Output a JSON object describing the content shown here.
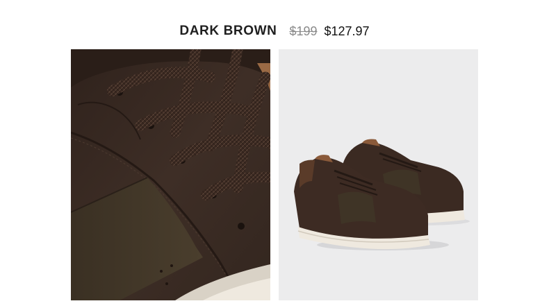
{
  "product": {
    "color_name": "DARK BROWN",
    "original_price": "$199",
    "sale_price": "$127.97"
  },
  "images": [
    {
      "name": "closeup-leather-laces",
      "content": "closeup-photo"
    },
    {
      "name": "pair-of-sneakers",
      "content": "product-photo"
    }
  ],
  "colors": {
    "leather": "#3b2a22",
    "suede_panel": "#3f3426",
    "sole": "#efe9df",
    "lining": "#8a5a3a",
    "background_gray": "#ececed"
  }
}
